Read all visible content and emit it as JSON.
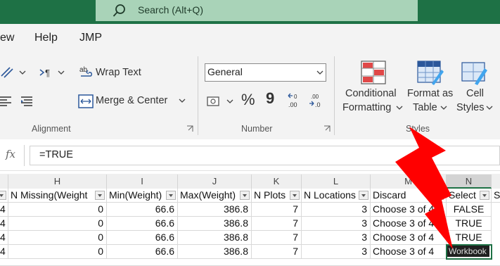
{
  "search": {
    "label": "Search (Alt+Q)"
  },
  "menu": {
    "items": [
      "ew",
      "Help",
      "JMP"
    ]
  },
  "ribbon": {
    "wrap_text": "Wrap Text",
    "merge_center": "Merge & Center",
    "alignment_label": "Alignment",
    "number_format": "General",
    "number_label": "Number",
    "percent_symbol": "%",
    "comma_symbol": "9",
    "conditional_formatting": [
      "Conditional",
      "Formatting"
    ],
    "format_as_table": [
      "Format as",
      "Table"
    ],
    "cell_styles": [
      "Cell",
      "Styles"
    ],
    "styles_label": "Styles"
  },
  "formula_bar": {
    "fx": "fx",
    "value": "=TRUE"
  },
  "grid": {
    "columns": [
      "H",
      "I",
      "J",
      "K",
      "L",
      "M",
      "N"
    ],
    "headers": [
      "N Missing(Weight",
      "Min(Weight)",
      "Max(Weight)",
      "N Plots",
      "N Locations",
      "Discard",
      "Select",
      "So"
    ],
    "rows": [
      {
        "g": "4",
        "h": "0",
        "i": "66.6",
        "j": "386.8",
        "k": "7",
        "l": "3",
        "m": "Choose 3 of 4",
        "n": "FALSE"
      },
      {
        "g": "4",
        "h": "0",
        "i": "66.6",
        "j": "386.8",
        "k": "7",
        "l": "3",
        "m": "Choose 3 of 4",
        "n": "TRUE"
      },
      {
        "g": "4",
        "h": "0",
        "i": "66.6",
        "j": "386.8",
        "k": "7",
        "l": "3",
        "m": "Choose 3 of 4",
        "n": "TRUE"
      },
      {
        "g": "4",
        "h": "0",
        "i": "66.6",
        "j": "386.8",
        "k": "7",
        "l": "3",
        "m": "Choose 3 of 4",
        "n": ""
      }
    ],
    "tooltip": "Workbook"
  },
  "colors": {
    "excel_green": "#1e7145",
    "search_bg": "#a9d3b8",
    "annotation_red": "#ff0000"
  }
}
